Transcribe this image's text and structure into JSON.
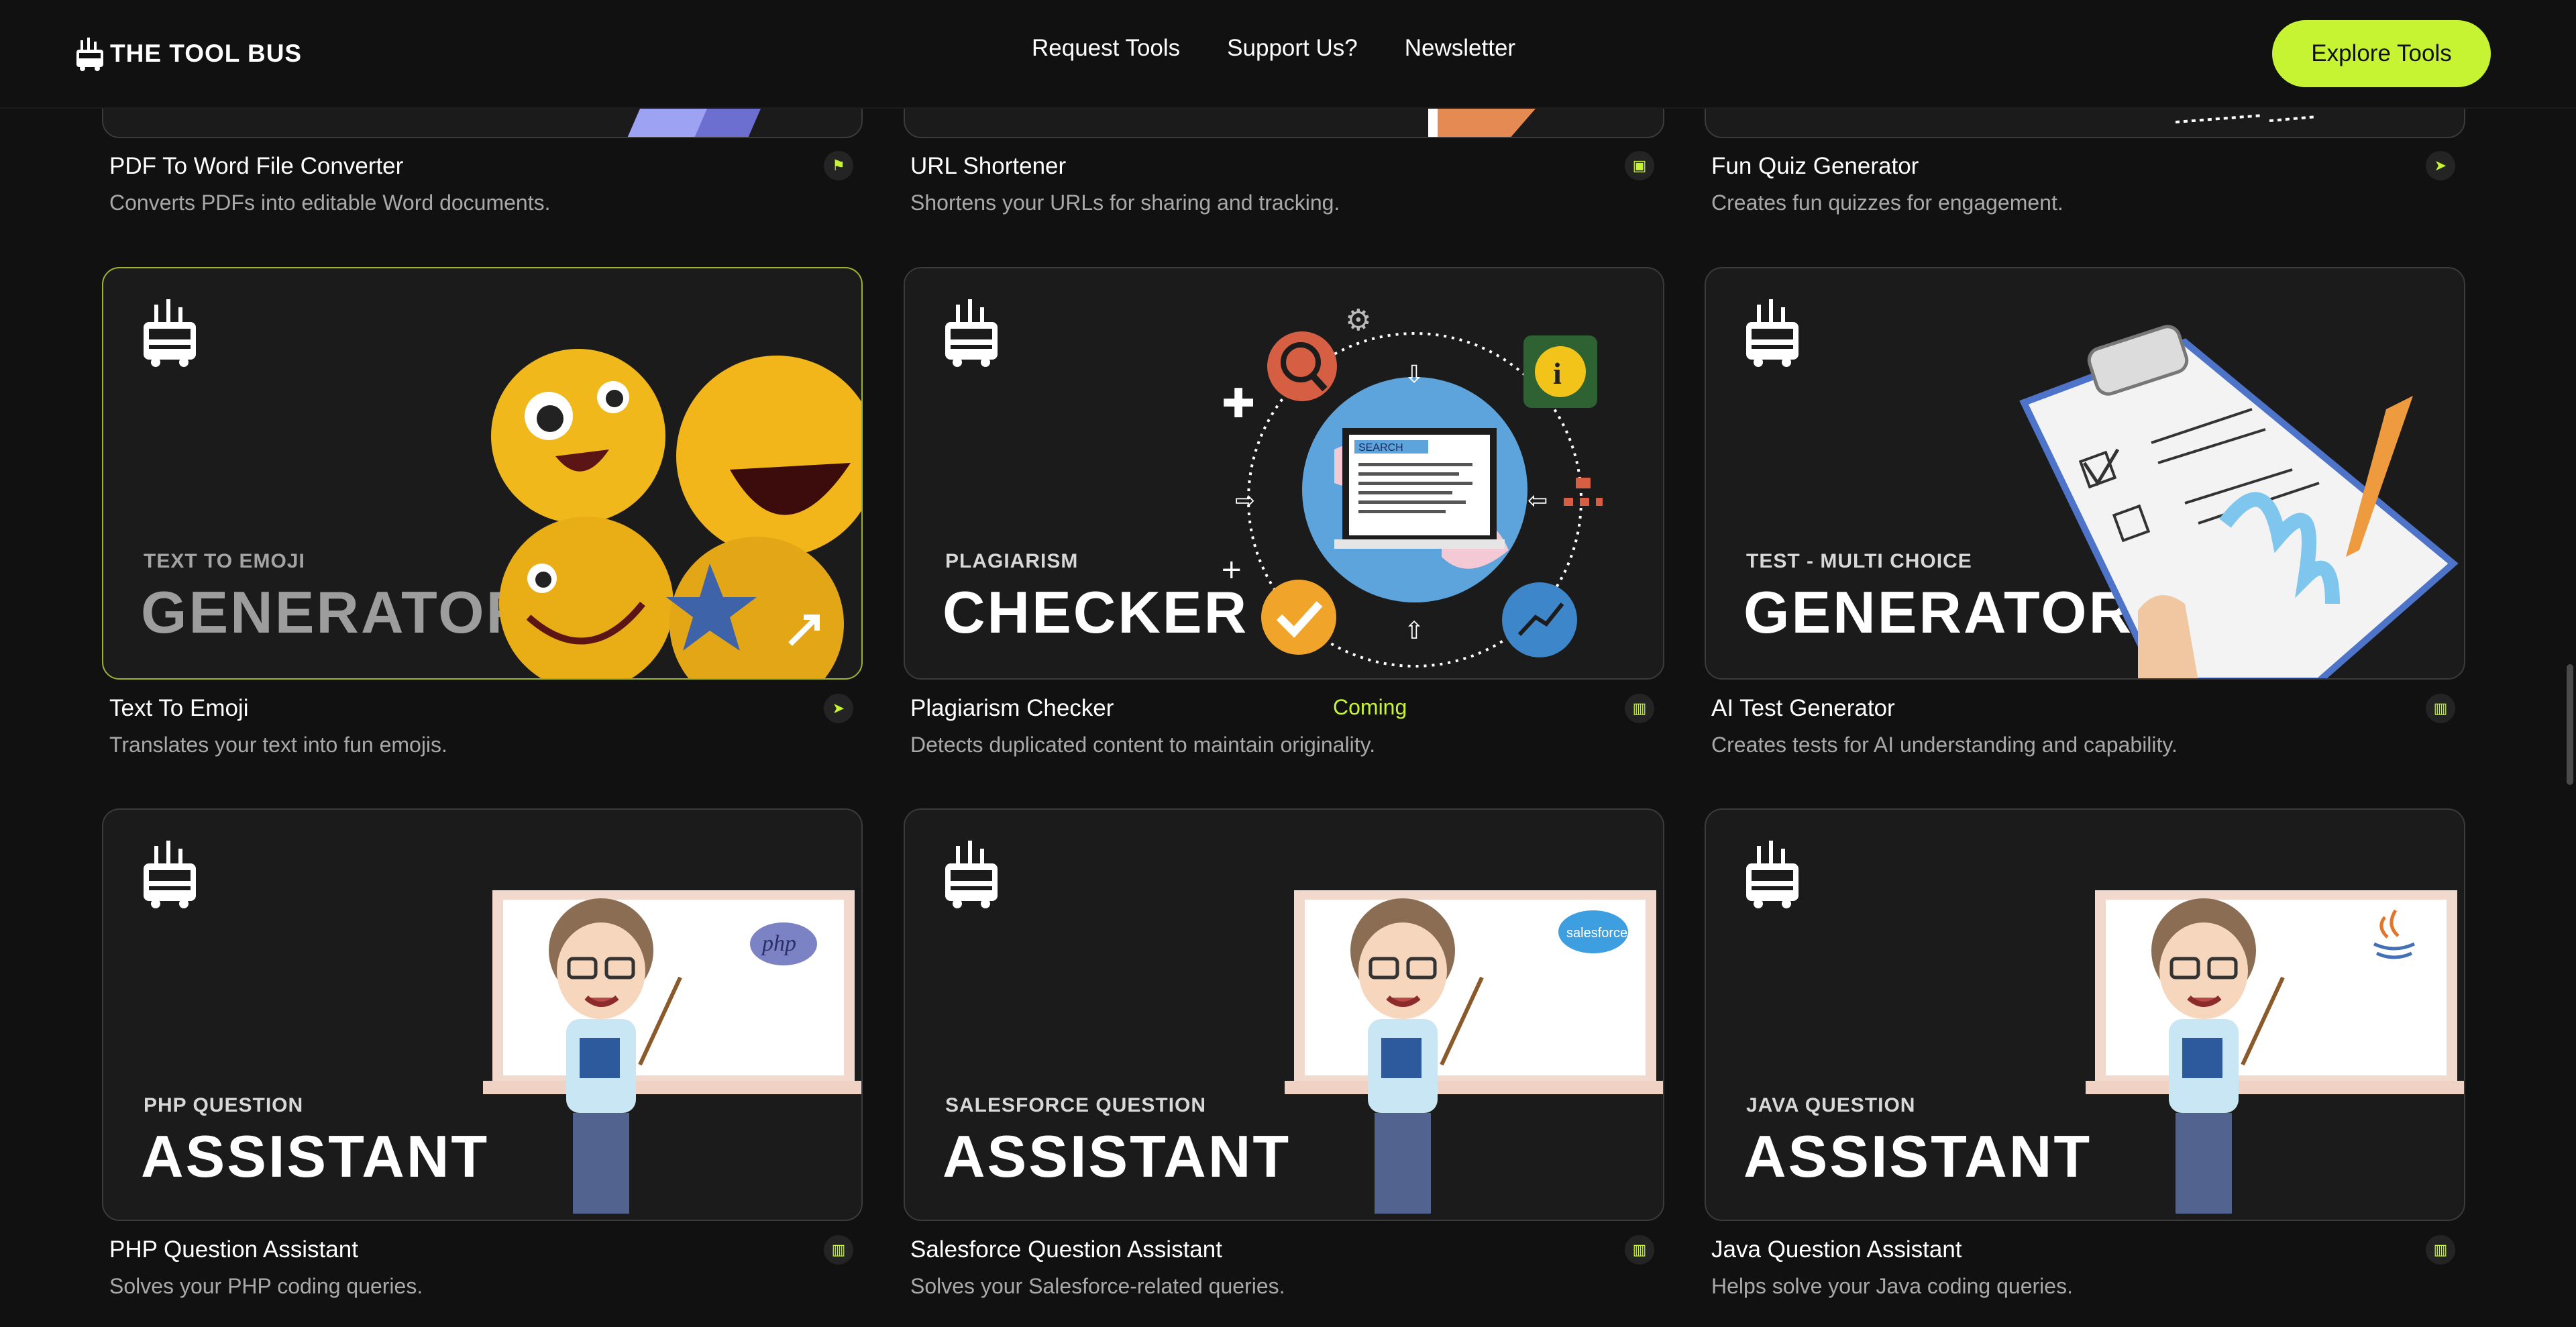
{
  "header": {
    "logo_text": "THE TOOL BUS",
    "nav": [
      "Request Tools",
      "Support Us?",
      "Newsletter"
    ],
    "cta_label": "Explore Tools",
    "accent": "#c6f432"
  },
  "cards": [
    {
      "title": "PDF To Word File Converter",
      "desc": "Converts PDFs into editable Word documents.",
      "icon": "flag-icon"
    },
    {
      "title": "URL Shortener",
      "desc": "Shortens your URLs for sharing and tracking.",
      "icon": "briefcase-icon"
    },
    {
      "title": "Fun Quiz Generator",
      "desc": "Creates fun quizzes for engagement.",
      "icon": "paper-plane-icon"
    },
    {
      "title": "Text To Emoji",
      "desc": "Translates your text into fun emojis.",
      "icon": "paper-plane-icon",
      "art_small": "TEXT TO EMOJI",
      "art_big": "GENERATOR"
    },
    {
      "title": "Plagiarism Checker",
      "desc": "Detects duplicated content to maintain originality.",
      "icon": "chart-icon",
      "badge": "Coming",
      "art_small": "PLAGIARISM",
      "art_big": "CHECKER",
      "search_label": "SEARCH"
    },
    {
      "title": "AI Test Generator",
      "desc": "Creates tests for AI understanding and capability.",
      "icon": "chart-icon",
      "art_small": "TEST - MULTI CHOICE",
      "art_big": "GENERATOR"
    },
    {
      "title": "PHP Question Assistant",
      "desc": "Solves your PHP coding queries.",
      "icon": "chart-icon",
      "art_small": "PHP QUESTION",
      "art_big": "ASSISTANT",
      "board_logo": "php"
    },
    {
      "title": "Salesforce Question Assistant",
      "desc": "Solves your Salesforce-related queries.",
      "icon": "chart-icon",
      "art_small": "SALESFORCE QUESTION",
      "art_big": "ASSISTANT",
      "board_logo": "salesforce"
    },
    {
      "title": "Java Question Assistant",
      "desc": "Helps solve your Java coding queries.",
      "icon": "chart-icon",
      "art_small": "JAVA QUESTION",
      "art_big": "ASSISTANT"
    }
  ]
}
